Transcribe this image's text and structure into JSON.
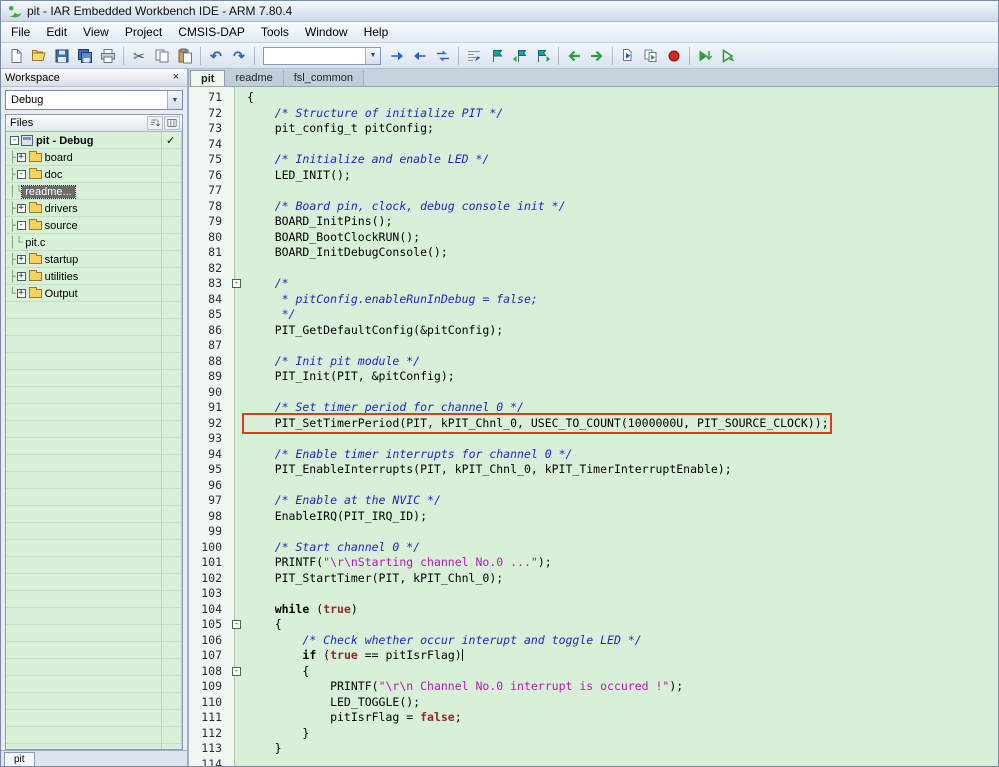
{
  "colors": {
    "editor_bg": "#d8f0d8",
    "highlight_red": "#df3b1e",
    "selection_bg": "#6b6b6b",
    "comment": "#2424c8",
    "string": "#b31ab3",
    "literal": "#8e2a2a"
  },
  "window": {
    "title": "pit - IAR Embedded Workbench IDE - ARM 7.80.4"
  },
  "menu": {
    "items": [
      "File",
      "Edit",
      "View",
      "Project",
      "CMSIS-DAP",
      "Tools",
      "Window",
      "Help"
    ]
  },
  "toolbar": {
    "combo_value": "",
    "buttons": [
      {
        "name": "new-file"
      },
      {
        "name": "open-file"
      },
      {
        "name": "save"
      },
      {
        "name": "save-all"
      },
      {
        "name": "print"
      },
      {
        "name": "sep"
      },
      {
        "name": "cut"
      },
      {
        "name": "copy"
      },
      {
        "name": "paste"
      },
      {
        "name": "sep"
      },
      {
        "name": "undo"
      },
      {
        "name": "redo"
      },
      {
        "name": "sep"
      },
      {
        "name": "find-combo"
      },
      {
        "name": "find-next"
      },
      {
        "name": "find-previous"
      },
      {
        "name": "replace"
      },
      {
        "name": "sep"
      },
      {
        "name": "goto"
      },
      {
        "name": "toggle-bookmark"
      },
      {
        "name": "previous-bookmark"
      },
      {
        "name": "next-bookmark"
      },
      {
        "name": "sep"
      },
      {
        "name": "navigate-backward"
      },
      {
        "name": "navigate-forward"
      },
      {
        "name": "sep"
      },
      {
        "name": "compile"
      },
      {
        "name": "make"
      },
      {
        "name": "toggle-breakpoint"
      },
      {
        "name": "sep"
      },
      {
        "name": "download-and-debug"
      },
      {
        "name": "debug-without-downloading"
      }
    ]
  },
  "workspace": {
    "title": "Workspace",
    "config": "Debug",
    "files_header": "Files",
    "bottom_tab": "pit",
    "check_mark": "✓",
    "tree": [
      {
        "label": "pit - Debug",
        "icon": "project",
        "level": 0,
        "expander": "minus",
        "bold": true,
        "checked": true
      },
      {
        "label": "board",
        "icon": "folder",
        "level": 1,
        "branch": "mid",
        "expander": "plus"
      },
      {
        "label": "doc",
        "icon": "folder",
        "level": 1,
        "branch": "mid",
        "expander": "minus"
      },
      {
        "label": "readme...",
        "icon": "document",
        "level": 2,
        "branch": "end",
        "selected": true
      },
      {
        "label": "drivers",
        "icon": "folder",
        "level": 1,
        "branch": "mid",
        "expander": "plus"
      },
      {
        "label": "source",
        "icon": "folder",
        "level": 1,
        "branch": "mid",
        "expander": "minus"
      },
      {
        "label": "pit.c",
        "icon": "document",
        "level": 2,
        "branch": "end"
      },
      {
        "label": "startup",
        "icon": "folder",
        "level": 1,
        "branch": "mid",
        "expander": "plus"
      },
      {
        "label": "utilities",
        "icon": "folder",
        "level": 1,
        "branch": "mid",
        "expander": "plus"
      },
      {
        "label": "Output",
        "icon": "folder",
        "level": 1,
        "branch": "end",
        "expander": "plus"
      }
    ]
  },
  "editor": {
    "tabs": [
      {
        "label": "pit",
        "active": true
      },
      {
        "label": "readme",
        "active": false
      },
      {
        "label": "fsl_common",
        "active": false
      }
    ],
    "lines": [
      {
        "n": 71,
        "seg": [
          [
            "p",
            "{"
          ]
        ]
      },
      {
        "n": 72,
        "seg": [
          [
            "p",
            "    "
          ],
          [
            "c",
            "/* Structure of initialize PIT */"
          ]
        ]
      },
      {
        "n": 73,
        "seg": [
          [
            "p",
            "    pit_config_t pitConfig;"
          ]
        ]
      },
      {
        "n": 74,
        "seg": []
      },
      {
        "n": 75,
        "seg": [
          [
            "p",
            "    "
          ],
          [
            "c",
            "/* Initialize and enable LED */"
          ]
        ]
      },
      {
        "n": 76,
        "seg": [
          [
            "p",
            "    LED_INIT();"
          ]
        ]
      },
      {
        "n": 77,
        "seg": []
      },
      {
        "n": 78,
        "seg": [
          [
            "p",
            "    "
          ],
          [
            "c",
            "/* Board pin, clock, debug console init */"
          ]
        ]
      },
      {
        "n": 79,
        "seg": [
          [
            "p",
            "    BOARD_InitPins();"
          ]
        ]
      },
      {
        "n": 80,
        "seg": [
          [
            "p",
            "    BOARD_BootClockRUN();"
          ]
        ]
      },
      {
        "n": 81,
        "seg": [
          [
            "p",
            "    BOARD_InitDebugConsole();"
          ]
        ]
      },
      {
        "n": 82,
        "seg": []
      },
      {
        "n": 83,
        "fold": true,
        "seg": [
          [
            "p",
            "    "
          ],
          [
            "c",
            "/*"
          ]
        ]
      },
      {
        "n": 84,
        "seg": [
          [
            "c",
            "     * pitConfig.enableRunInDebug = false;"
          ]
        ]
      },
      {
        "n": 85,
        "seg": [
          [
            "c",
            "     */"
          ]
        ]
      },
      {
        "n": 86,
        "seg": [
          [
            "p",
            "    PIT_GetDefaultConfig(&pitConfig);"
          ]
        ]
      },
      {
        "n": 87,
        "seg": []
      },
      {
        "n": 88,
        "seg": [
          [
            "p",
            "    "
          ],
          [
            "c",
            "/* Init pit module */"
          ]
        ]
      },
      {
        "n": 89,
        "seg": [
          [
            "p",
            "    PIT_Init(PIT, &pitConfig);"
          ]
        ]
      },
      {
        "n": 90,
        "seg": []
      },
      {
        "n": 91,
        "seg": [
          [
            "p",
            "    "
          ],
          [
            "c",
            "/* Set timer period for channel 0 */"
          ]
        ]
      },
      {
        "n": 92,
        "hl": true,
        "seg": [
          [
            "p",
            "    PIT_SetTimerPeriod(PIT, kPIT_Chnl_0, USEC_TO_COUNT(1000000U, PIT_SOURCE_CLOCK));"
          ]
        ]
      },
      {
        "n": 93,
        "seg": []
      },
      {
        "n": 94,
        "seg": [
          [
            "p",
            "    "
          ],
          [
            "c",
            "/* Enable timer interrupts for channel 0 */"
          ]
        ]
      },
      {
        "n": 95,
        "seg": [
          [
            "p",
            "    PIT_EnableInterrupts(PIT, kPIT_Chnl_0, kPIT_TimerInterruptEnable);"
          ]
        ]
      },
      {
        "n": 96,
        "seg": []
      },
      {
        "n": 97,
        "seg": [
          [
            "p",
            "    "
          ],
          [
            "c",
            "/* Enable at the NVIC */"
          ]
        ]
      },
      {
        "n": 98,
        "seg": [
          [
            "p",
            "    EnableIRQ(PIT_IRQ_ID);"
          ]
        ]
      },
      {
        "n": 99,
        "seg": []
      },
      {
        "n": 100,
        "seg": [
          [
            "p",
            "    "
          ],
          [
            "c",
            "/* Start channel 0 */"
          ]
        ]
      },
      {
        "n": 101,
        "seg": [
          [
            "p",
            "    PRINTF("
          ],
          [
            "s",
            "\"\\r\\nStarting channel No.0 ...\""
          ],
          [
            "p",
            ");"
          ]
        ]
      },
      {
        "n": 102,
        "seg": [
          [
            "p",
            "    PIT_StartTimer(PIT, kPIT_Chnl_0);"
          ]
        ]
      },
      {
        "n": 103,
        "seg": []
      },
      {
        "n": 104,
        "seg": [
          [
            "p",
            "    "
          ],
          [
            "k",
            "while"
          ],
          [
            "p",
            " ("
          ],
          [
            "b",
            "true"
          ],
          [
            "p",
            ")"
          ]
        ]
      },
      {
        "n": 105,
        "fold": true,
        "seg": [
          [
            "p",
            "    {"
          ]
        ]
      },
      {
        "n": 106,
        "seg": [
          [
            "p",
            "        "
          ],
          [
            "c",
            "/* Check whether occur interupt and toggle LED */"
          ]
        ]
      },
      {
        "n": 107,
        "caret": true,
        "seg": [
          [
            "p",
            "        "
          ],
          [
            "k",
            "if"
          ],
          [
            "p",
            " ("
          ],
          [
            "b",
            "true"
          ],
          [
            "p",
            " == pitIsrFlag)"
          ]
        ]
      },
      {
        "n": 108,
        "fold": true,
        "seg": [
          [
            "p",
            "        {"
          ]
        ]
      },
      {
        "n": 109,
        "seg": [
          [
            "p",
            "            PRINTF("
          ],
          [
            "s",
            "\"\\r\\n Channel No.0 interrupt is occured !\""
          ],
          [
            "p",
            ");"
          ]
        ]
      },
      {
        "n": 110,
        "seg": [
          [
            "p",
            "            LED_TOGGLE();"
          ]
        ]
      },
      {
        "n": 111,
        "seg": [
          [
            "p",
            "            pitIsrFlag = "
          ],
          [
            "b",
            "false"
          ],
          [
            "p",
            ";"
          ]
        ]
      },
      {
        "n": 112,
        "seg": [
          [
            "p",
            "        }"
          ]
        ]
      },
      {
        "n": 113,
        "seg": [
          [
            "p",
            "    }"
          ]
        ]
      },
      {
        "n": 114,
        "seg": []
      }
    ]
  }
}
